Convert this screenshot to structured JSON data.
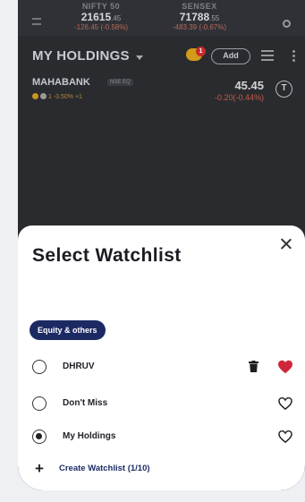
{
  "indices": [
    {
      "name": "NIFTY 50",
      "value": "21615",
      "decimals": ".45",
      "change": "-126.45 (-0.58%)"
    },
    {
      "name": "SENSEX",
      "value": "71788",
      "decimals": ".55",
      "change": "-483.39 (-0.67%)"
    }
  ],
  "holdings": {
    "title": "MY HOLDINGS",
    "notification_count": "1",
    "add_label": "Add"
  },
  "stock": {
    "name": "MAHABANK",
    "exchange": "NSE EQ",
    "meta": "1 -3.50%   +1",
    "price": "45.45",
    "change": "-0.20(-0.44%)",
    "trade_label": "T"
  },
  "sheet": {
    "title": "Select Watchlist",
    "chip_label": "Equity & others",
    "watchlists": [
      {
        "name": "DHRUV",
        "selected": false,
        "favorite": true,
        "deletable": true
      },
      {
        "name": "Don't Miss",
        "selected": false,
        "favorite": false,
        "deletable": false
      },
      {
        "name": "My Holdings",
        "selected": true,
        "favorite": false,
        "deletable": false
      }
    ],
    "create_label": "Create Watchlist (1/10)"
  },
  "colors": {
    "accent": "#1c2a63",
    "favorite": "#d0283b",
    "negative": "#c25c4c"
  }
}
